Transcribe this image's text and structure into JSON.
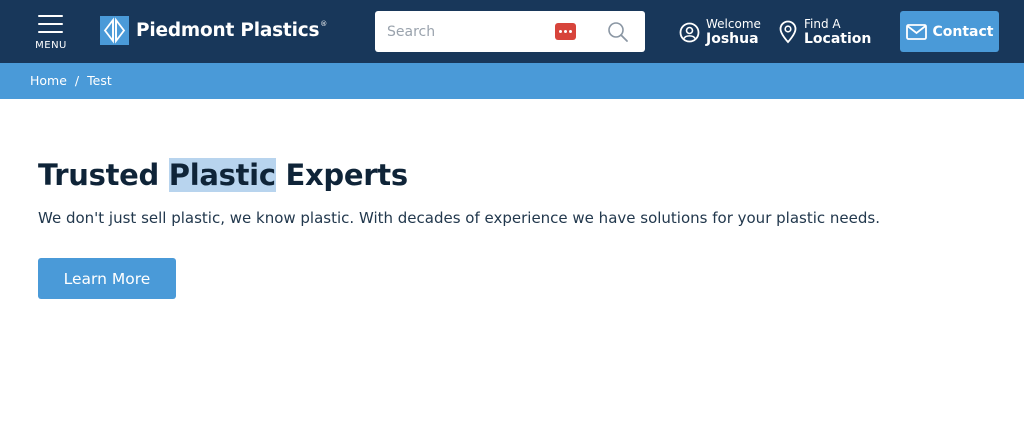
{
  "header": {
    "menu_label": "MENU",
    "logo_text": "Piedmont Plastics",
    "logo_mark": "®",
    "search_placeholder": "Search",
    "welcome_line1": "Welcome",
    "welcome_name": "Joshua",
    "find_line1": "Find A",
    "find_line2": "Location",
    "contact_label": "Contact"
  },
  "breadcrumb": {
    "home": "Home",
    "separator": "/",
    "current": "Test"
  },
  "hero": {
    "title_before": "Trusted ",
    "title_highlight": "Plastic",
    "title_after": " Experts",
    "description": "We don't just sell plastic, we know plastic. With decades of experience we have solutions for your plastic needs.",
    "button_label": "Learn More"
  },
  "icons": {
    "menu": "hamburger-icon",
    "search": "search-icon",
    "password_manager": "password-dots-icon",
    "user": "user-circle-icon",
    "location": "map-pin-icon",
    "mail": "envelope-icon"
  },
  "colors": {
    "header_bg": "#18375a",
    "accent": "#4a9ad8",
    "title": "#0f2438",
    "highlight": "#b8d4ee"
  }
}
